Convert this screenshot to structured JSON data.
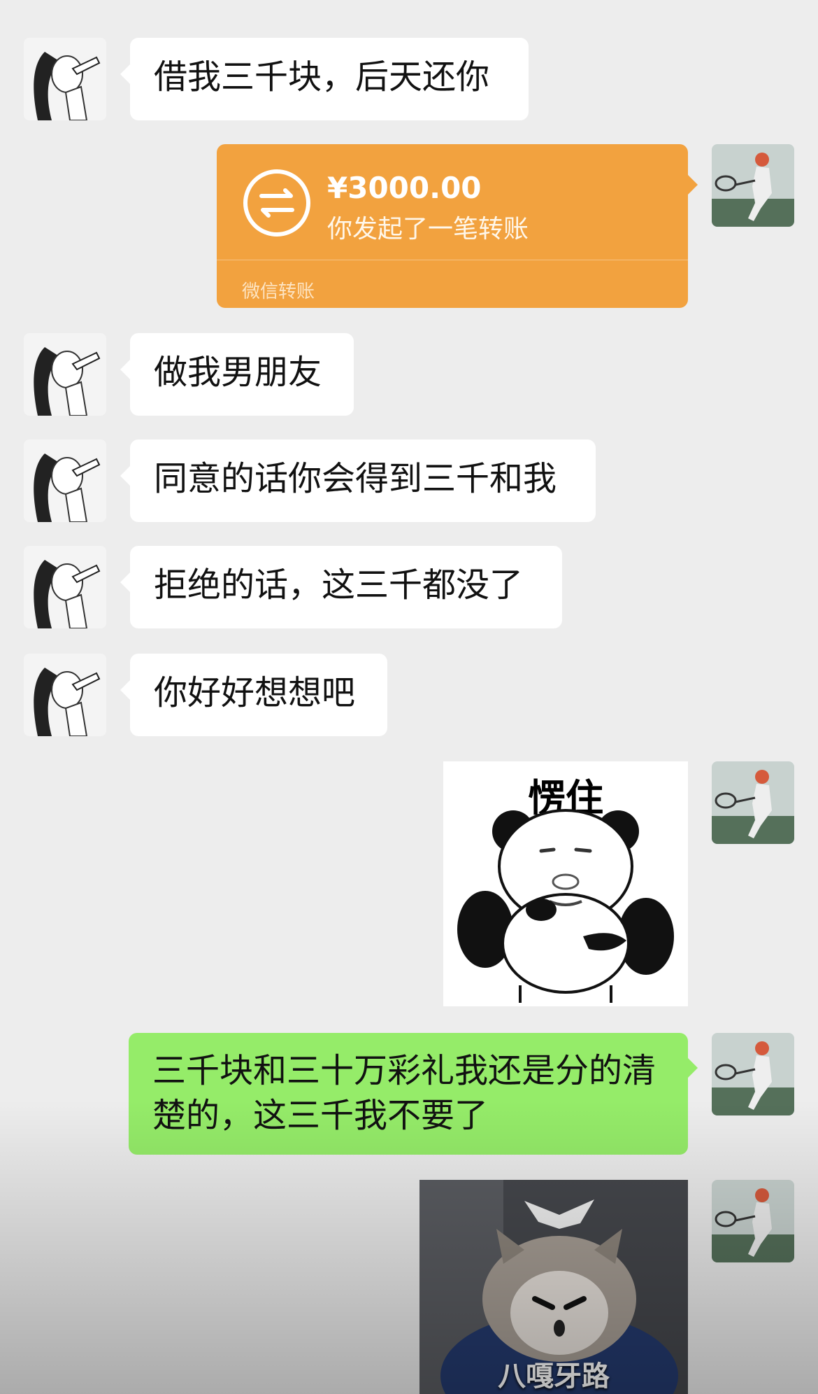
{
  "messages": {
    "m1": {
      "text": "借我三千块，后天还你"
    },
    "transfer": {
      "amount": "¥3000.00",
      "desc": "你发起了一笔转账",
      "footer": "微信转账",
      "icon": "transfer-arrows-icon",
      "color": "#f2a23f"
    },
    "m2": {
      "text": "做我男朋友"
    },
    "m3": {
      "text": "同意的话你会得到三千和我"
    },
    "m4": {
      "text": "拒绝的话，这三千都没了"
    },
    "m5": {
      "text": "你好好想想吧"
    },
    "sticker_panda": {
      "caption": "愣住"
    },
    "reply": {
      "text": "三千块和三十万彩礼我还是分的清楚的，这三千我不要了",
      "color": "#95ec69"
    },
    "sticker_cat": {
      "caption": "八嘎牙路"
    }
  },
  "colors": {
    "background": "#ededed",
    "bubble_left": "#ffffff",
    "bubble_right": "#95ec69"
  }
}
